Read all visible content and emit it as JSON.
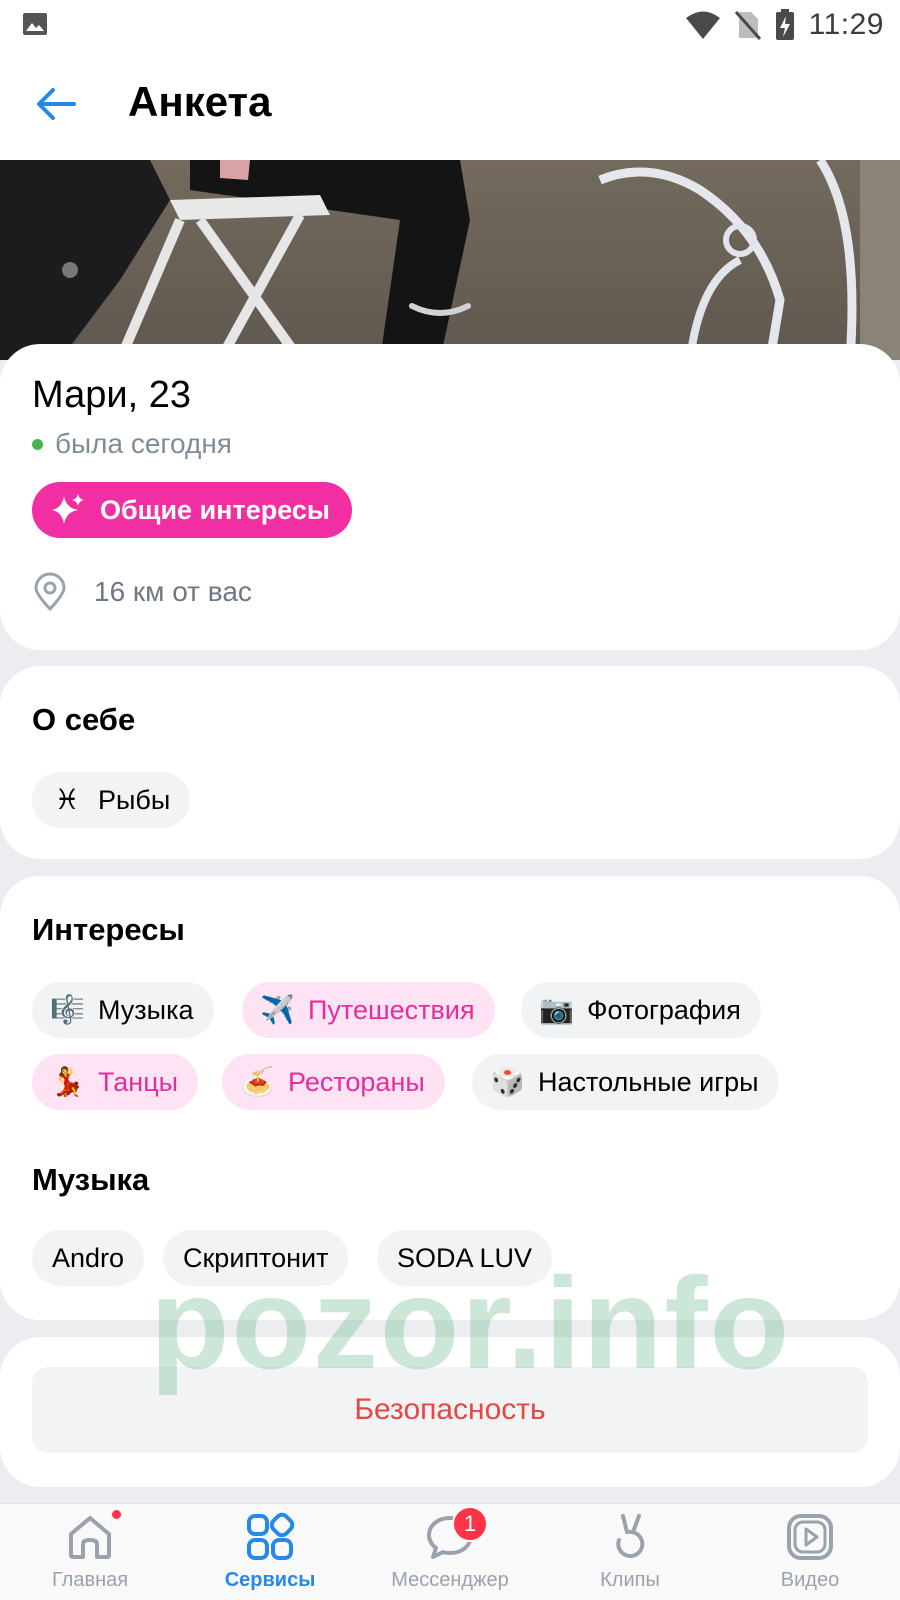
{
  "status_bar": {
    "time": "11:29"
  },
  "header": {
    "title": "Анкета"
  },
  "profile": {
    "name_age": "Мари, 23",
    "status": "была сегодня",
    "common_interests_label": "Общие интересы",
    "distance": "16 км от вас"
  },
  "about": {
    "title": "О себе",
    "zodiac": {
      "emoji": "♓",
      "label": "Рыбы"
    }
  },
  "interests": {
    "title": "Интересы",
    "items": [
      {
        "emoji": "🎼",
        "label": "Музыка",
        "highlight": false
      },
      {
        "emoji": "✈️",
        "label": "Путешествия",
        "highlight": true
      },
      {
        "emoji": "📷",
        "label": "Фотография",
        "highlight": false
      },
      {
        "emoji": "💃",
        "label": "Танцы",
        "highlight": true
      },
      {
        "emoji": "🍝",
        "label": "Рестораны",
        "highlight": true
      },
      {
        "emoji": "🎲",
        "label": "Настольные игры",
        "highlight": false
      }
    ]
  },
  "music": {
    "title": "Музыка",
    "artists": [
      "Andro",
      "Скриптонит",
      "SODA LUV"
    ]
  },
  "safety": {
    "label": "Безопасность"
  },
  "watermark": "pozor.info",
  "tabbar": {
    "tabs": [
      {
        "label": "Главная",
        "icon": "home-icon",
        "active": false
      },
      {
        "label": "Сервисы",
        "icon": "services-icon",
        "active": true
      },
      {
        "label": "Мессенджер",
        "icon": "messenger-icon",
        "active": false,
        "badge": "1"
      },
      {
        "label": "Клипы",
        "icon": "clips-icon",
        "active": false
      },
      {
        "label": "Видео",
        "icon": "video-icon",
        "active": false
      }
    ]
  },
  "colors": {
    "accent": "#2688eb",
    "pink": "#f12fa3",
    "pink_soft": "#fde3f3",
    "danger": "#e64646",
    "online": "#4bb34b"
  }
}
